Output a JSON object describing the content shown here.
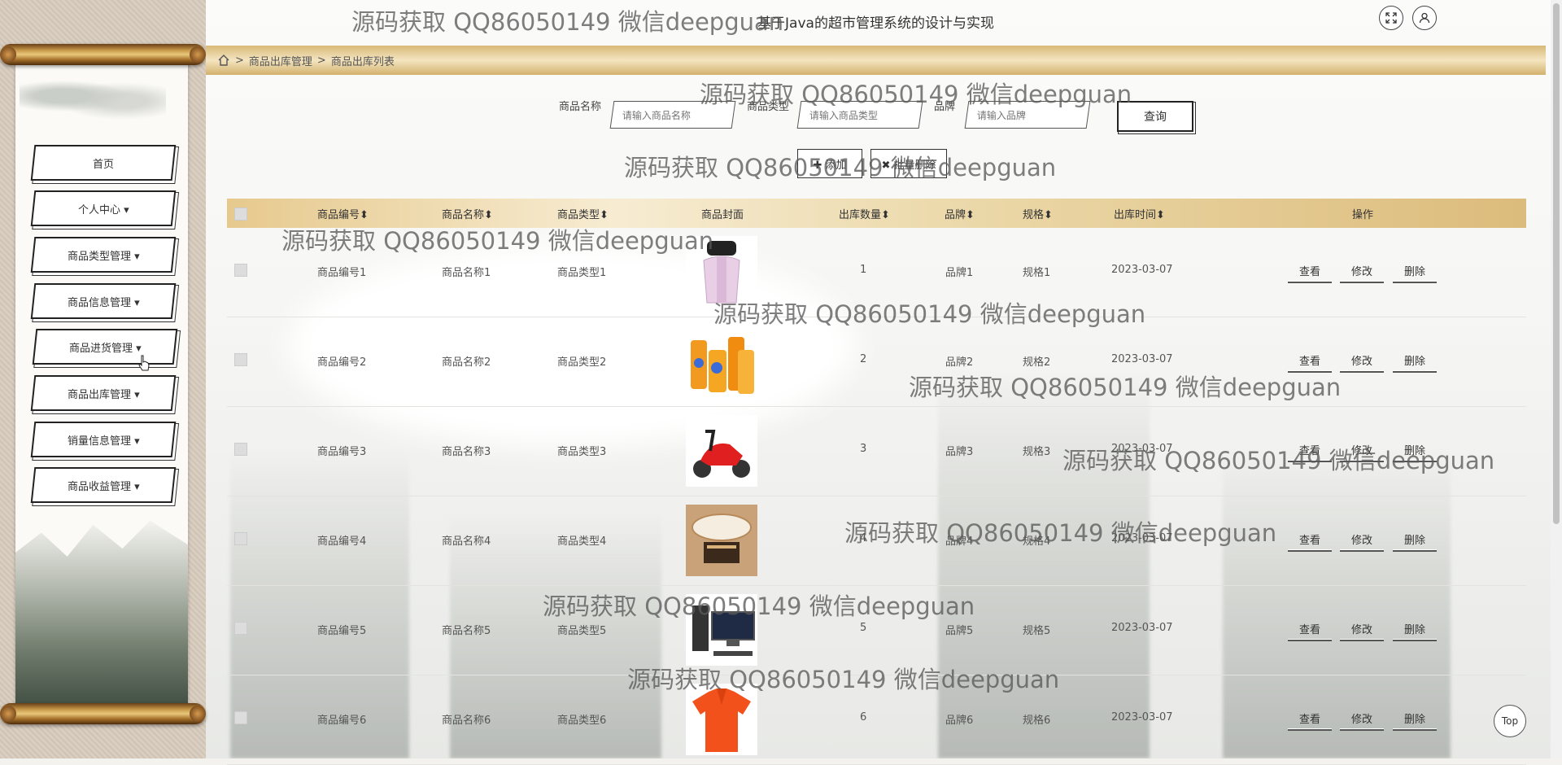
{
  "app_title": "基于Java的超市管理系统的设计与实现",
  "breadcrumb": {
    "sep": ">",
    "items": [
      "商品出库管理",
      "商品出库列表"
    ]
  },
  "sidebar": {
    "items": [
      {
        "label": "首页"
      },
      {
        "label": "个人中心 ▾"
      },
      {
        "label": "商品类型管理 ▾"
      },
      {
        "label": "商品信息管理 ▾"
      },
      {
        "label": "商品进货管理 ▾"
      },
      {
        "label": "商品出库管理 ▾"
      },
      {
        "label": "销量信息管理 ▾"
      },
      {
        "label": "商品收益管理 ▾"
      }
    ]
  },
  "search": {
    "name_label": "商品名称",
    "name_placeholder": "请输入商品名称",
    "type_label": "商品类型",
    "type_placeholder": "请输入商品类型",
    "brand_label": "品牌",
    "brand_placeholder": "请输入品牌",
    "query_label": "查询"
  },
  "toolbar": {
    "add_label": "✚ 添加",
    "delete_label": "✖ 批量删除"
  },
  "table": {
    "headers": {
      "code": "商品编号⬍",
      "name": "商品名称⬍",
      "type": "商品类型⬍",
      "cover": "商品封面",
      "qty": "出库数量⬍",
      "brand": "品牌⬍",
      "spec": "规格⬍",
      "time": "出库时间⬍",
      "ops": "操作"
    },
    "actions": {
      "view": "查看",
      "edit": "修改",
      "delete": "删除"
    },
    "rows": [
      {
        "code": "商品编号1",
        "name": "商品名称1",
        "type": "商品类型1",
        "qty": "1",
        "brand": "品牌1",
        "spec": "规格1",
        "time": "2023-03-07",
        "cover": "vest"
      },
      {
        "code": "商品编号2",
        "name": "商品名称2",
        "type": "商品类型2",
        "qty": "2",
        "brand": "品牌2",
        "spec": "规格2",
        "time": "2023-03-07",
        "cover": "juice"
      },
      {
        "code": "商品编号3",
        "name": "商品名称3",
        "type": "商品类型3",
        "qty": "3",
        "brand": "品牌3",
        "spec": "规格3",
        "time": "2023-03-07",
        "cover": "scooter"
      },
      {
        "code": "商品编号4",
        "name": "商品名称4",
        "type": "商品类型4",
        "qty": "4",
        "brand": "品牌4",
        "spec": "规格4",
        "time": "2023-03-07",
        "cover": "lamp"
      },
      {
        "code": "商品编号5",
        "name": "商品名称5",
        "type": "商品类型5",
        "qty": "5",
        "brand": "品牌5",
        "spec": "规格5",
        "time": "2023-03-07",
        "cover": "computer"
      },
      {
        "code": "商品编号6",
        "name": "商品名称6",
        "type": "商品类型6",
        "qty": "6",
        "brand": "品牌6",
        "spec": "规格6",
        "time": "2023-03-07",
        "cover": "polo-shirt"
      }
    ]
  },
  "watermark_text": "源码获取 QQ86050149 微信deepguan",
  "top_label": "Top",
  "icons": {
    "fullscreen": "fullscreen-icon",
    "user": "user-icon",
    "home": "home-icon"
  }
}
